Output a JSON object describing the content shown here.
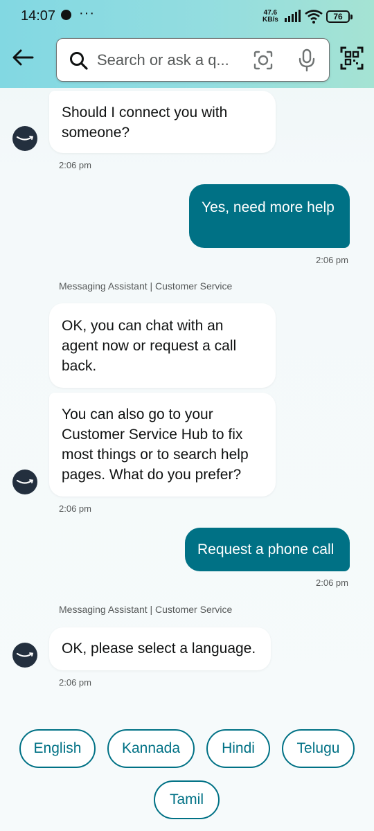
{
  "status_bar": {
    "time": "14:07",
    "more": "···",
    "net_speed_value": "47.6",
    "net_speed_unit": "KB/s",
    "battery": "76"
  },
  "search": {
    "placeholder": "Search or ask a q...",
    "icons": [
      "back-arrow-icon",
      "search-icon",
      "camera-lens-icon",
      "microphone-icon",
      "qr-scan-icon"
    ]
  },
  "chat": {
    "messages": [
      {
        "from": "bot",
        "text": "Should I connect you with someone?",
        "time": "2:06 pm"
      },
      {
        "from": "user",
        "text": "Yes, need more help",
        "time": "2:06 pm"
      },
      {
        "from": "bot",
        "sender": "Messaging Assistant | Customer Service",
        "text1": "OK, you can chat with an agent now or request a call back.",
        "text2": "You can also go to your Customer Service Hub to fix most things or to search help pages. What do you prefer?",
        "time": "2:06 pm"
      },
      {
        "from": "user",
        "text": "Request a phone call",
        "time": "2:06 pm"
      },
      {
        "from": "bot",
        "sender": "Messaging Assistant | Customer Service",
        "text": "OK, please select a language.",
        "time": "2:06 pm"
      }
    ]
  },
  "quick_replies": [
    "English",
    "Kannada",
    "Hindi",
    "Telugu",
    "Tamil"
  ],
  "colors": {
    "accent": "#007185",
    "header_start": "#82d8e2",
    "header_end": "#a5e3d3",
    "avatar": "#232f3e"
  }
}
